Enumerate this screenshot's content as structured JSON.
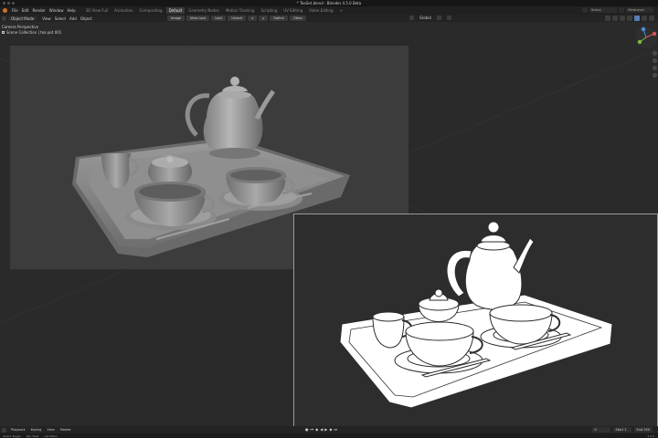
{
  "window": {
    "title": "* TeaSet.blend - Blender 4.5.0 Beta"
  },
  "menubar": {
    "menus": [
      "File",
      "Edit",
      "Render",
      "Window",
      "Help"
    ],
    "tabs": [
      {
        "label": "3D View Full",
        "active": false
      },
      {
        "label": "Animation",
        "active": false
      },
      {
        "label": "Compositing",
        "active": false
      },
      {
        "label": "Default",
        "active": true
      },
      {
        "label": "Geometry Nodes",
        "active": false
      },
      {
        "label": "Motion Tracking",
        "active": false
      },
      {
        "label": "Scripting",
        "active": false
      },
      {
        "label": "UV Editing",
        "active": false
      },
      {
        "label": "Video Editing",
        "active": false
      },
      {
        "label": "+",
        "active": false
      }
    ],
    "scene_field": "Scene",
    "layer_field": "ViewLayer"
  },
  "header": {
    "mode": "Object Mode",
    "view": "View",
    "select": "Select",
    "add": "Add",
    "object": "Object",
    "tools": [
      "Image",
      "View Lock",
      "Lock",
      "Unlock",
      "x",
      "y",
      "Switch",
      "Other"
    ],
    "transform": "Global"
  },
  "viewport": {
    "perspective_label": "Camera Perspective",
    "collection_label": "Scene Collection | tea pot 001",
    "accent_x": "#e0525a",
    "accent_y": "#84b83d",
    "accent_z": "#4f8fdb"
  },
  "timeline": {
    "playback": "Playback",
    "keying": "Keying",
    "view": "View",
    "marker": "Marker",
    "current_frame": "0",
    "start_label": "Start",
    "start": "1",
    "end_label": "End",
    "end": "250"
  },
  "statusbar": {
    "items": [
      "Select Toggle",
      "Pan View",
      "Call Menu"
    ],
    "version": "4.5.0"
  }
}
